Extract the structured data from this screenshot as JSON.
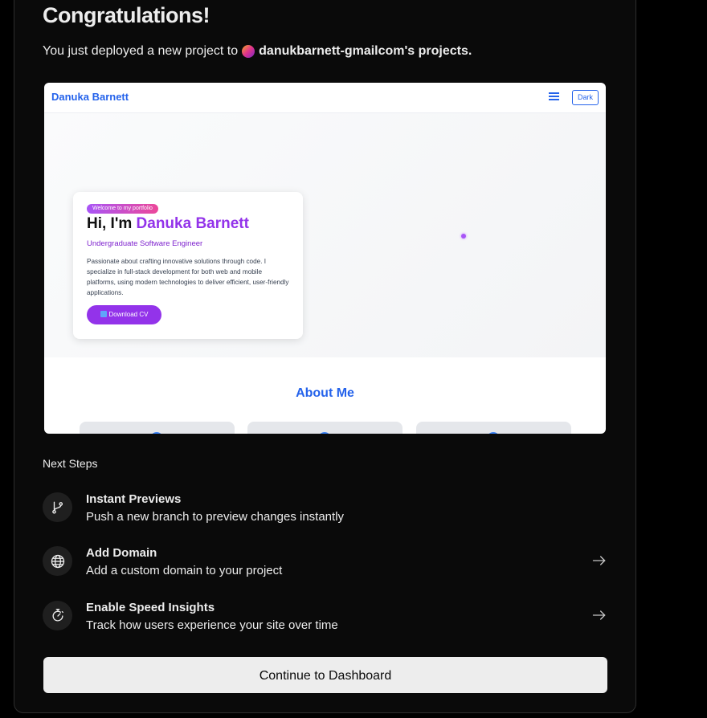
{
  "header": {
    "title": "Congratulations!",
    "subtitle_prefix": "You just deployed a new project to",
    "team_name": "danukbarnett-gmailcom's projects."
  },
  "preview": {
    "brand": "Danuka Barnett",
    "theme_button": "Dark",
    "badge": "Welcome to my portfolio",
    "greeting": "Hi, I'm",
    "name": "Danuka Barnett",
    "role": "Undergraduate Software Engineer",
    "description": "Passionate about crafting innovative solutions through code. I specialize in full-stack development for both web and mobile platforms, using modern technologies to deliver efficient, user-friendly applications.",
    "cv_button": "Download CV",
    "about_heading": "About Me"
  },
  "next_steps": {
    "heading": "Next Steps",
    "items": [
      {
        "title": "Instant Previews",
        "description": "Push a new branch to preview changes instantly",
        "icon": "git-branch-icon",
        "has_arrow": false
      },
      {
        "title": "Add Domain",
        "description": "Add a custom domain to your project",
        "icon": "globe-icon",
        "has_arrow": true
      },
      {
        "title": "Enable Speed Insights",
        "description": "Track how users experience your site over time",
        "icon": "stopwatch-icon",
        "has_arrow": true
      }
    ]
  },
  "cta": {
    "label": "Continue to Dashboard"
  },
  "colors": {
    "background": "#000000",
    "panel": "#0a0a0a",
    "accent_blue": "#2563eb",
    "accent_purple": "#9333ea",
    "button_bg": "#ededed"
  }
}
